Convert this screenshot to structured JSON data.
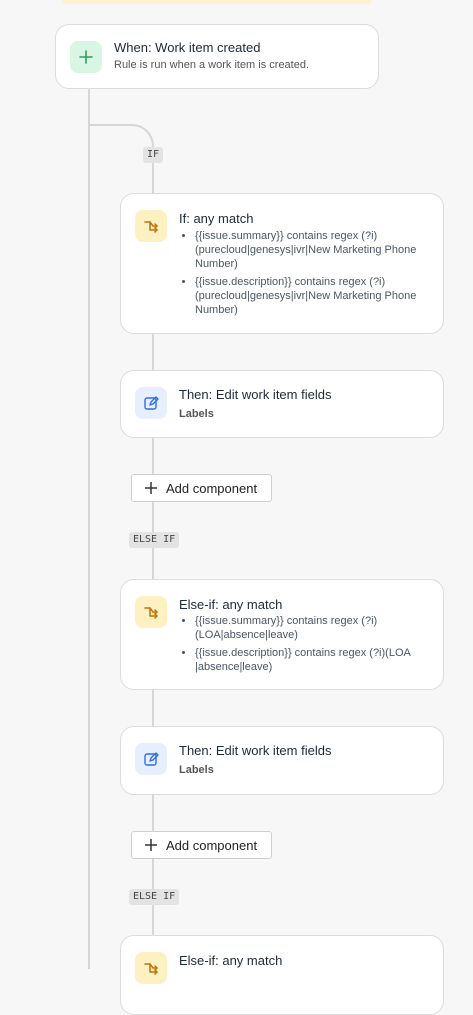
{
  "trigger": {
    "icon": "plus-icon",
    "title": "When: Work item created",
    "subtitle": "Rule is run when a work item is created."
  },
  "branches": {
    "if_badge": "IF",
    "else_if_badge": "ELSE IF"
  },
  "if_block": {
    "icon": "branch-icon",
    "title": "If: any match",
    "conditions": [
      "{{issue.summary}} contains regex (?i)(purecloud|genesys|ivr|New Marketing Phone Number)",
      "{{issue.description}} contains regex (?i)(purecloud|genesys|ivr|New Marketing Phone Number)"
    ]
  },
  "then_1": {
    "icon": "edit-icon",
    "title": "Then: Edit work item fields",
    "label": "Labels"
  },
  "add_component_label": "Add component",
  "else_if_1": {
    "icon": "branch-icon",
    "title": "Else-if: any match",
    "conditions": [
      "{{issue.summary}} contains regex (?i)(LOA|absence|leave)",
      "{{issue.description}} contains regex (?i)(LOA |absence|leave)"
    ]
  },
  "then_2": {
    "icon": "edit-icon",
    "title": "Then: Edit work item fields",
    "label": "Labels"
  },
  "else_if_2": {
    "icon": "branch-icon",
    "title": "Else-if: any match"
  },
  "colors": {
    "trigger_icon_bg": "#d9f5e4",
    "trigger_icon": "#2f9e64",
    "condition_icon_bg": "#fdf1c2",
    "condition_icon": "#c2700a",
    "edit_icon_bg": "#e7efff",
    "edit_icon": "#2f6fe0",
    "connector": "#d6d6d6"
  }
}
